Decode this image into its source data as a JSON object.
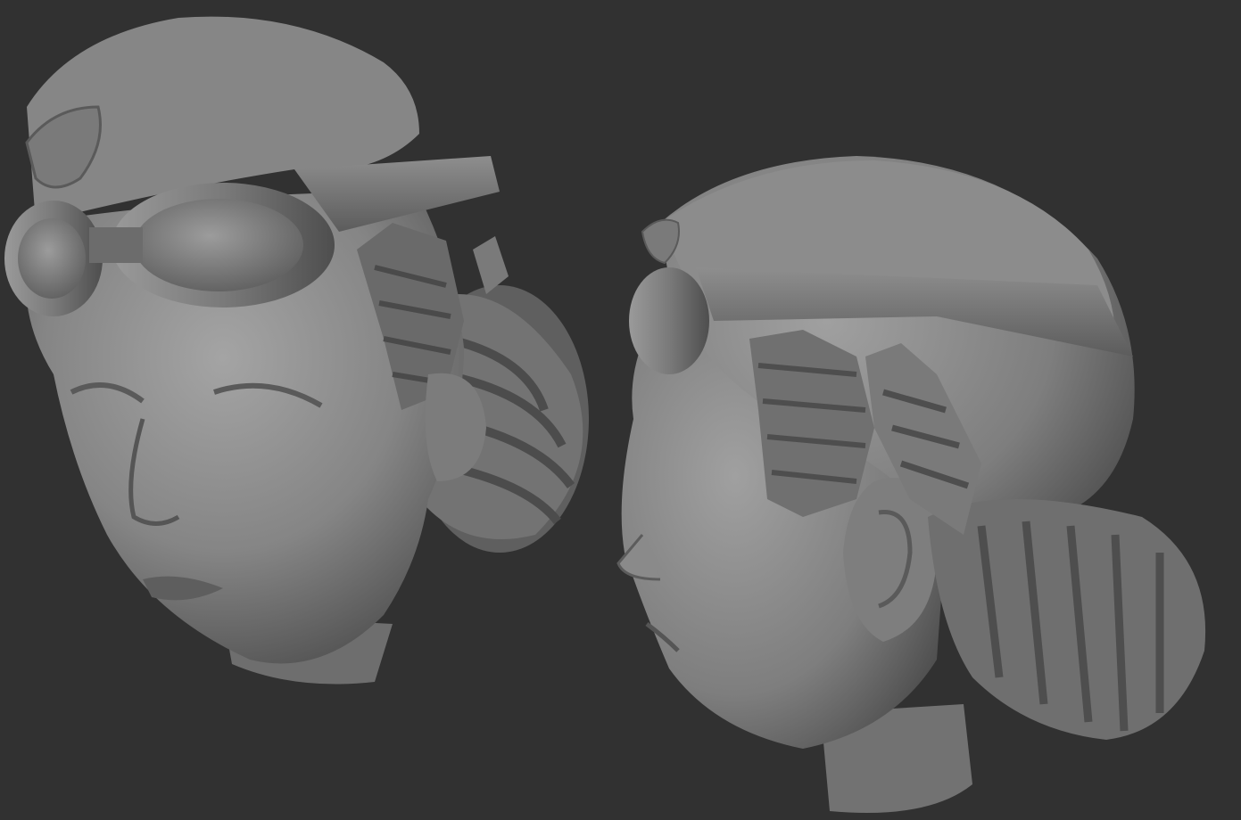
{
  "scene": {
    "background_color": "#313131",
    "model_color": "#8a8a8a",
    "subject": "two-views-of-sculpted-head",
    "views": [
      {
        "name": "three-quarter-front-view"
      },
      {
        "name": "side-view"
      }
    ]
  }
}
